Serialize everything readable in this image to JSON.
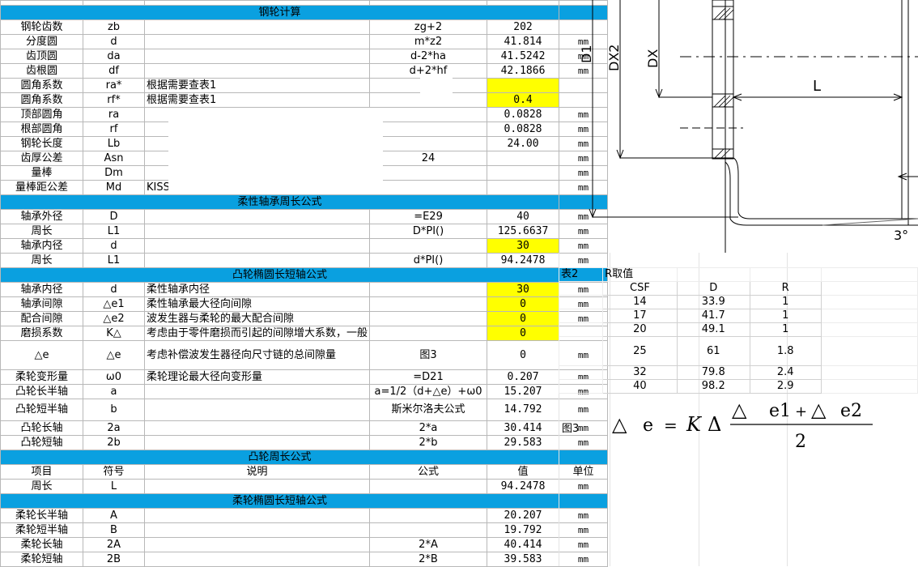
{
  "top_partial": {
    "c1": "量棒距公差",
    "c2": "Md",
    "c3": "KISSsoft计算",
    "c6": "mm"
  },
  "sections": {
    "gear": "钢轮计算",
    "flex_bearing": "柔性轴承周长公式",
    "cam_ellipse": "凸轮椭圆长短轴公式",
    "cam_perimeter": "凸轮周长公式",
    "flex_ellipse": "柔轮椭圆长短轴公式"
  },
  "gear_rows": [
    {
      "name": "钢轮齿数",
      "sym": "zb",
      "desc": "",
      "formula": "zg+2",
      "value": "202",
      "unit": ""
    },
    {
      "name": "分度圆",
      "sym": "d",
      "desc": "",
      "formula": "m*z2",
      "value": "41.814",
      "unit": "mm"
    },
    {
      "name": "齿顶圆",
      "sym": "da",
      "desc": "",
      "formula": "d-2*ha",
      "value": "41.5242",
      "unit": "mm"
    },
    {
      "name": "齿根圆",
      "sym": "df",
      "desc": "",
      "formula": "d+2*hf",
      "value": "42.1866",
      "unit": "mm"
    },
    {
      "name": "圆角系数",
      "sym": "ra*",
      "desc": "根据需要查表1",
      "formula": "",
      "value": "",
      "unit": "",
      "yellow": true
    },
    {
      "name": "圆角系数",
      "sym": "rf*",
      "desc": "根据需要查表1",
      "formula": "",
      "value": "0.4",
      "unit": "",
      "yellow": true
    },
    {
      "name": "顶部圆角",
      "sym": "ra",
      "desc": "",
      "formula": "",
      "value": "0.0828",
      "unit": "mm"
    },
    {
      "name": "根部圆角",
      "sym": "rf",
      "desc": "",
      "formula": "",
      "value": "0.0828",
      "unit": "mm"
    },
    {
      "name": "钢轮长度",
      "sym": "Lb",
      "desc": "",
      "formula": "",
      "value": "24.00",
      "unit": "mm"
    },
    {
      "name": "齿厚公差",
      "sym": "Asn",
      "desc": "",
      "formula": "24",
      "value": "",
      "unit": "mm"
    },
    {
      "name": "量棒",
      "sym": "Dm",
      "desc": "",
      "formula": "",
      "value": "",
      "unit": "mm"
    },
    {
      "name": "量棒距公差",
      "sym": "Md",
      "desc": "KISSsoft计算",
      "formula": "",
      "value": "",
      "unit": "mm"
    }
  ],
  "bearing_rows": [
    {
      "name": "轴承外径",
      "sym": "D",
      "desc": "",
      "formula": "=E29",
      "value": "40",
      "unit": "mm"
    },
    {
      "name": "周长",
      "sym": "L1",
      "desc": "",
      "formula": "D*PI()",
      "value": "125.6637",
      "unit": "mm"
    },
    {
      "name": "轴承内径",
      "sym": "d",
      "desc": "",
      "formula": "",
      "value": "30",
      "unit": "mm",
      "yellow": true
    },
    {
      "name": "周长",
      "sym": "L1",
      "desc": "",
      "formula": "d*PI()",
      "value": "94.2478",
      "unit": "mm"
    }
  ],
  "cam_rows": [
    {
      "name": "轴承内径",
      "sym": "d",
      "desc": "柔性轴承内径",
      "formula": "",
      "value": "30",
      "unit": "mm",
      "yellow": true
    },
    {
      "name": "轴承间隙",
      "sym": "△e1",
      "desc": "柔性轴承最大径向间隙",
      "formula": "",
      "value": "0",
      "unit": "mm",
      "yellow": true
    },
    {
      "name": "配合间隙",
      "sym": "△e2",
      "desc": "波发生器与柔轮的最大配合间隙",
      "formula": "",
      "value": "0",
      "unit": "mm",
      "yellow": true
    },
    {
      "name": "磨损系数",
      "sym": "K△",
      "desc": "考虑由于零件磨损而引起的间隙增大系数，一般",
      "formula": "",
      "value": "0",
      "unit": "",
      "yellow": true
    },
    {
      "name": "△e",
      "sym": "△e",
      "desc": "考虑补偿波发生器径向尺寸链的总间隙量",
      "formula": "图3",
      "value": "0",
      "unit": "mm",
      "tall": true
    },
    {
      "name": "柔轮变形量",
      "sym": "ω0",
      "desc": "柔轮理论最大径向变形量",
      "formula": "=D21",
      "value": "0.207",
      "unit": "mm"
    },
    {
      "name": "凸轮长半轴",
      "sym": "a",
      "desc": "",
      "formula": "a=1/2（d+△e）+ω0",
      "value": "15.207",
      "unit": "mm"
    },
    {
      "name": "凸轮短半轴",
      "sym": "b",
      "desc": "",
      "formula": "斯米尔洛夫公式",
      "value": "14.792",
      "unit": "mm",
      "mid": true
    },
    {
      "name": "凸轮长轴",
      "sym": "2a",
      "desc": "",
      "formula": "2*a",
      "value": "30.414",
      "unit": "mm"
    },
    {
      "name": "凸轮短轴",
      "sym": "2b",
      "desc": "",
      "formula": "2*b",
      "value": "29.583",
      "unit": "mm"
    }
  ],
  "perimeter_header": {
    "c1": "项目",
    "c2": "符号",
    "c3": "说明",
    "c4": "公式",
    "c5": "值",
    "c6": "单位"
  },
  "perimeter_rows": [
    {
      "name": "周长",
      "sym": "L",
      "desc": "",
      "formula": "",
      "value": "94.2478",
      "unit": "mm"
    }
  ],
  "flex_rows": [
    {
      "name": "柔轮长半轴",
      "sym": "A",
      "desc": "",
      "formula": "",
      "value": "20.207",
      "unit": "mm"
    },
    {
      "name": "柔轮短半轴",
      "sym": "B",
      "desc": "",
      "formula": "",
      "value": "19.792",
      "unit": "mm"
    },
    {
      "name": "柔轮长轴",
      "sym": "2A",
      "desc": "",
      "formula": "2*A",
      "value": "40.414",
      "unit": "mm"
    },
    {
      "name": "柔轮短轴",
      "sym": "2B",
      "desc": "",
      "formula": "2*B",
      "value": "39.583",
      "unit": "mm"
    }
  ],
  "table2": {
    "label": "表2",
    "title": "R取值",
    "headers": [
      "CSF",
      "D",
      "R"
    ],
    "rows": [
      [
        "14",
        "33.9",
        "1"
      ],
      [
        "17",
        "41.7",
        "1"
      ],
      [
        "20",
        "49.1",
        "1"
      ],
      [
        "25",
        "61",
        "1.8"
      ],
      [
        "32",
        "79.8",
        "2.4"
      ],
      [
        "40",
        "98.2",
        "2.9"
      ]
    ]
  },
  "fig3": {
    "label": "图3",
    "lhs": "e",
    "eq": "=",
    "K": "K",
    "num1": "e1",
    "plus": "+",
    "num2": "e2",
    "den": "2"
  },
  "drawing": {
    "labels": [
      "D1",
      "DX2",
      "DX",
      "L",
      "3°"
    ]
  }
}
